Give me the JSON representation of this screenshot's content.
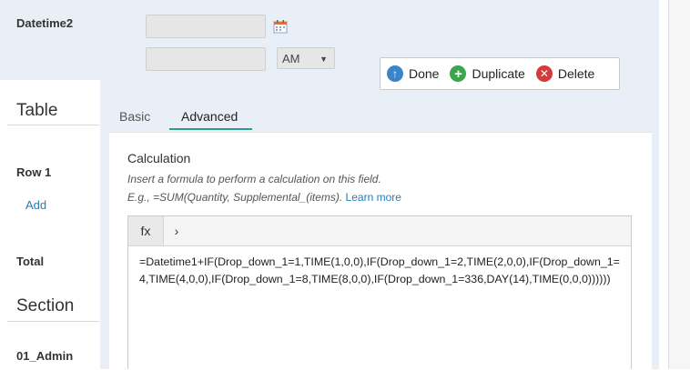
{
  "datetime": {
    "label": "Datetime2",
    "ampm_selected": "AM",
    "calendar_icon": "calendar-icon"
  },
  "actions": {
    "done": "Done",
    "duplicate": "Duplicate",
    "delete": "Delete"
  },
  "sidebar": {
    "table_title": "Table",
    "row_label": "Row 1",
    "add_link": "Add",
    "total_label": "Total",
    "section_title": "Section",
    "admin_label": "01_Admin"
  },
  "tabs": [
    {
      "label": "Basic",
      "active": false
    },
    {
      "label": "Advanced",
      "active": true
    }
  ],
  "calculation": {
    "title": "Calculation",
    "help": "Insert a formula to perform a calculation on this field.",
    "example_prefix": "E.g., =SUM(Quantity, Supplemental_(items).",
    "learn_more": "Learn more",
    "fx_label": "fx",
    "chevron": "›",
    "formula": "=Datetime1+IF(Drop_down_1=1,TIME(1,0,0),IF(Drop_down_1=2,TIME(2,0,0),IF(Drop_down_1=4,TIME(4,0,0),IF(Drop_down_1=8,TIME(8,0,0),IF(Drop_down_1=336,DAY(14),TIME(0,0,0))))))"
  },
  "colors": {
    "panel_bg": "#e9eff7",
    "accent_tab": "#2a9d8f",
    "link": "#1e7fb8",
    "done_icon": "#3b84c8",
    "duplicate_icon": "#3aa54a",
    "delete_icon": "#d43b3b"
  }
}
